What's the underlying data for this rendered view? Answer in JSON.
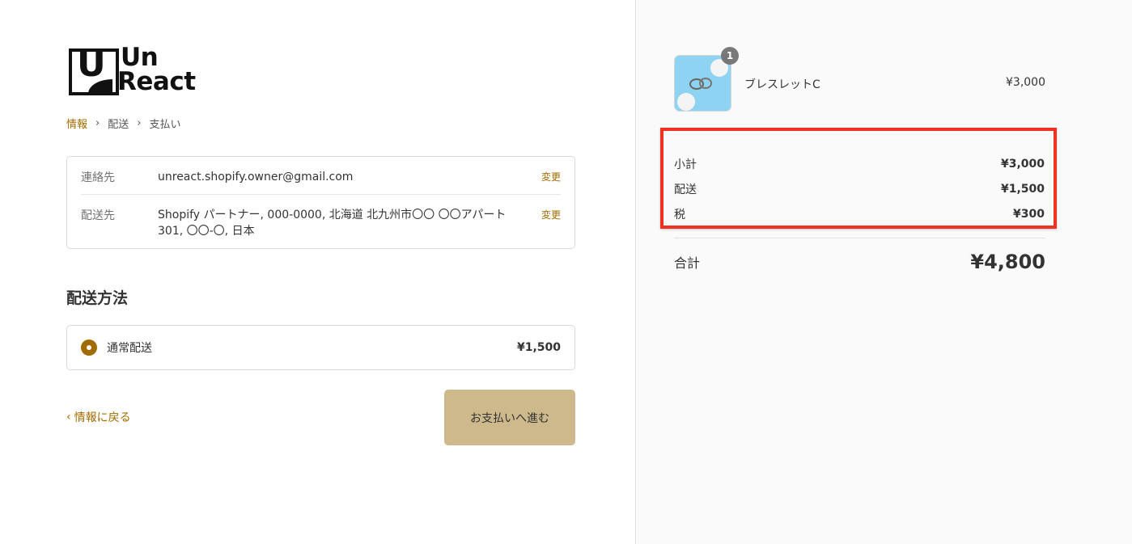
{
  "logo": {
    "line1": "Un",
    "line2": "React",
    "box_letter": "U"
  },
  "breadcrumb": {
    "step1": "情報",
    "step2": "配送",
    "step3": "支払い"
  },
  "review": {
    "contact_label": "連絡先",
    "contact_value": "unreact.shopify.owner@gmail.com",
    "ship_to_label": "配送先",
    "ship_to_value": "Shopify パートナー, 000-0000, 北海道 北九州市〇〇 〇〇アパート301, 〇〇-〇, 日本",
    "change_label": "変更"
  },
  "shipping_method": {
    "title": "配送方法",
    "option_name": "通常配送",
    "option_price": "¥1,500",
    "selected": true
  },
  "nav": {
    "back_label": "情報に戻る",
    "continue_label": "お支払いへ進む"
  },
  "order": {
    "product": {
      "name": "ブレスレットC",
      "price": "¥3,000",
      "quantity": "1"
    },
    "subtotal_label": "小計",
    "subtotal_value": "¥3,000",
    "shipping_label": "配送",
    "shipping_value": "¥1,500",
    "tax_label": "税",
    "tax_value": "¥300",
    "total_label": "合計",
    "total_value": "¥4,800"
  },
  "colors": {
    "accent": "#a26b00",
    "button": "#cdb98b",
    "highlight": "#ef3124",
    "sidebar_bg": "#fafafa"
  }
}
